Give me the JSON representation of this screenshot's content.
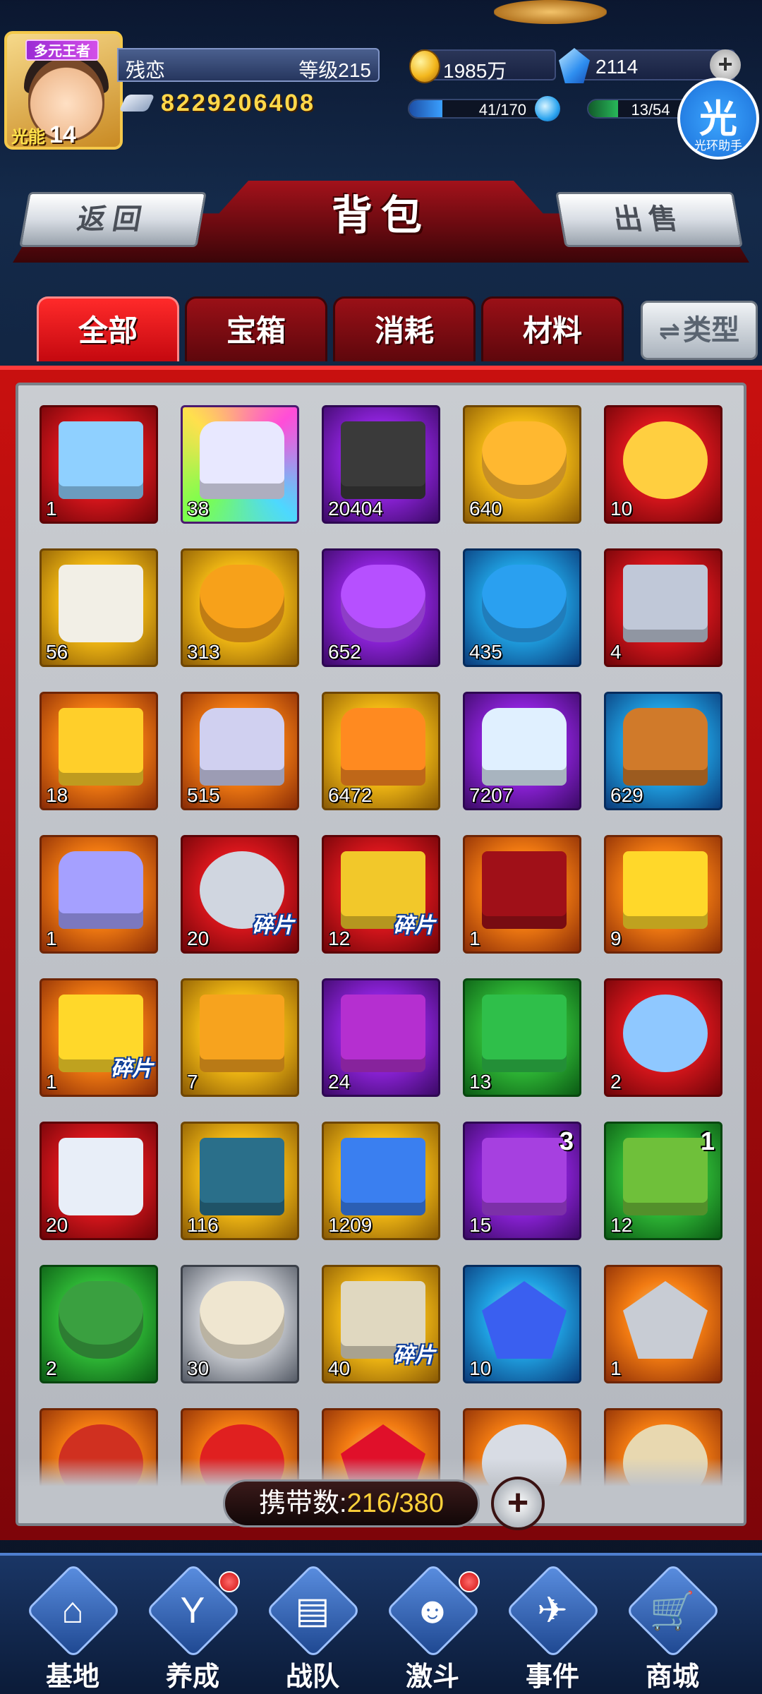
{
  "player": {
    "avatar_title": "多元王者",
    "energy_label": "光能",
    "energy_level": "14",
    "name": "残恋",
    "level": "等级215",
    "power": "8229206408"
  },
  "resources": {
    "gold": "1985万",
    "gems": "2114",
    "stamina": "41/170",
    "stamina_fraction": 0.24,
    "exp": "13/54",
    "exp_fraction": 0.24
  },
  "assistant": {
    "glyph": "光",
    "label": "光环助手"
  },
  "header": {
    "title": "背包",
    "back_label": "返回",
    "sell_label": "出售"
  },
  "tabs": [
    {
      "label": "全部",
      "active": true
    },
    {
      "label": "宝箱",
      "active": false
    },
    {
      "label": "消耗",
      "active": false
    },
    {
      "label": "材料",
      "active": false
    }
  ],
  "type_button": {
    "label": "类型",
    "icon": "swap-arrows-icon"
  },
  "items": [
    {
      "name": "blue-box",
      "qty": "1",
      "rarity": "red",
      "shape": "box",
      "color": "#8fd0ff"
    },
    {
      "name": "diamond-chest",
      "qty": "38",
      "rarity": "rainbow",
      "shape": "chest",
      "color": "#e8e8ff"
    },
    {
      "name": "weapon-case",
      "qty": "20404",
      "rarity": "purple",
      "shape": "box",
      "color": "#3a3a3a"
    },
    {
      "name": "gold-pouch",
      "qty": "640",
      "rarity": "gold",
      "shape": "bag",
      "color": "#ffb830"
    },
    {
      "name": "fire-orb",
      "qty": "10",
      "rarity": "red",
      "shape": "round",
      "color": "#ffcf40"
    },
    {
      "name": "claw-pack",
      "qty": "56",
      "rarity": "gold",
      "shape": "tag",
      "color": "#f2efe6"
    },
    {
      "name": "orange-bag",
      "qty": "313",
      "rarity": "gold",
      "shape": "bag",
      "color": "#f7a11a"
    },
    {
      "name": "purple-bag",
      "qty": "652",
      "rarity": "purple",
      "shape": "bag",
      "color": "#b650ff"
    },
    {
      "name": "blue-bag",
      "qty": "435",
      "rarity": "blue",
      "shape": "bag",
      "color": "#2aa0f0"
    },
    {
      "name": "core-cube",
      "qty": "4",
      "rarity": "red",
      "shape": "box",
      "color": "#c0c8d8"
    },
    {
      "name": "gold-mecha-box",
      "qty": "18",
      "rarity": "orange",
      "shape": "box",
      "color": "#ffcf2a"
    },
    {
      "name": "silver-mecha-chest",
      "qty": "515",
      "rarity": "orange",
      "shape": "chest",
      "color": "#d0d0f0"
    },
    {
      "name": "gold-chest",
      "qty": "6472",
      "rarity": "gold",
      "shape": "chest",
      "color": "#ff8a20"
    },
    {
      "name": "silver-chest",
      "qty": "7207",
      "rarity": "purple",
      "shape": "chest",
      "color": "#e0f0ff"
    },
    {
      "name": "wood-chest",
      "qty": "629",
      "rarity": "blue",
      "shape": "chest",
      "color": "#d07a2a"
    },
    {
      "name": "star-chest",
      "qty": "1",
      "rarity": "orange",
      "shape": "chest",
      "color": "#a5a0ff"
    },
    {
      "name": "crest-shard",
      "qty": "20",
      "rarity": "red",
      "shape": "round",
      "color": "#d0d6e0",
      "shard": "碎片"
    },
    {
      "name": "helmet-shard",
      "qty": "12",
      "rarity": "red",
      "shape": "box",
      "color": "#f2c82a",
      "shard": "碎片"
    },
    {
      "name": "red-crate",
      "qty": "1",
      "rarity": "orange",
      "shape": "box",
      "color": "#a01018"
    },
    {
      "name": "gold-crate",
      "qty": "9",
      "rarity": "orange",
      "shape": "box",
      "color": "#ffd82a"
    },
    {
      "name": "gold-crate-shard",
      "qty": "1",
      "rarity": "orange",
      "shape": "box",
      "color": "#ffd82a",
      "shard": "碎片"
    },
    {
      "name": "orange-crate",
      "qty": "7",
      "rarity": "gold",
      "shape": "box",
      "color": "#f7a31e"
    },
    {
      "name": "purple-crate",
      "qty": "24",
      "rarity": "purple",
      "shape": "box",
      "color": "#b52fd0"
    },
    {
      "name": "green-crate",
      "qty": "13",
      "rarity": "green",
      "shape": "box",
      "color": "#2fbf4a"
    },
    {
      "name": "blue-emblem",
      "qty": "2",
      "rarity": "red",
      "shape": "round",
      "color": "#8fc8ff"
    },
    {
      "name": "charm-tag",
      "qty": "20",
      "rarity": "red",
      "shape": "tag",
      "color": "#e8eef8"
    },
    {
      "name": "chip-board",
      "qty": "116",
      "rarity": "gold",
      "shape": "box",
      "color": "#2a6f8a"
    },
    {
      "name": "gift-box",
      "qty": "1209",
      "rarity": "gold",
      "shape": "box",
      "color": "#3a7ff0"
    },
    {
      "name": "purple-gift",
      "qty": "15",
      "rarity": "purple",
      "shape": "box",
      "color": "#a640e0",
      "corner": "3"
    },
    {
      "name": "green-gift",
      "qty": "12",
      "rarity": "green",
      "shape": "box",
      "color": "#6fc03a",
      "corner": "1"
    },
    {
      "name": "green-pouch",
      "qty": "2",
      "rarity": "green",
      "shape": "bag",
      "color": "#3aa040"
    },
    {
      "name": "white-pouch",
      "qty": "30",
      "rarity": "white",
      "shape": "bag",
      "color": "#efe6d0"
    },
    {
      "name": "star-case-shard",
      "qty": "40",
      "rarity": "gold",
      "shape": "box",
      "color": "#e0d8c0",
      "shard": "碎片"
    },
    {
      "name": "blue-crystal",
      "qty": "10",
      "rarity": "blue",
      "shape": "gem",
      "color": "#3a5ff0"
    },
    {
      "name": "silver-ore",
      "qty": "1",
      "rarity": "orange",
      "shape": "gem",
      "color": "#c8ccd4"
    },
    {
      "name": "claw-relic",
      "qty": "",
      "rarity": "orange",
      "shape": "round",
      "color": "#d03020"
    },
    {
      "name": "crescent-relic",
      "qty": "",
      "rarity": "orange",
      "shape": "round",
      "color": "#e02020"
    },
    {
      "name": "ruby",
      "qty": "",
      "rarity": "orange",
      "shape": "gem",
      "color": "#e0102a"
    },
    {
      "name": "silver-ring",
      "qty": "",
      "rarity": "orange",
      "shape": "ring",
      "color": "#d8dce4"
    },
    {
      "name": "spiked-orb",
      "qty": "",
      "rarity": "orange",
      "shape": "round",
      "color": "#e8d8b0"
    }
  ],
  "capacity": {
    "label": "携带数:",
    "value": "216/380"
  },
  "nav": [
    {
      "label": "基地",
      "glyph": "⌂",
      "dot": false
    },
    {
      "label": "养成",
      "glyph": "Y",
      "dot": true
    },
    {
      "label": "战队",
      "glyph": "▤",
      "dot": false
    },
    {
      "label": "激斗",
      "glyph": "☻",
      "dot": true
    },
    {
      "label": "事件",
      "glyph": "✈",
      "dot": false
    },
    {
      "label": "商城",
      "glyph": "🛒",
      "dot": false
    }
  ]
}
